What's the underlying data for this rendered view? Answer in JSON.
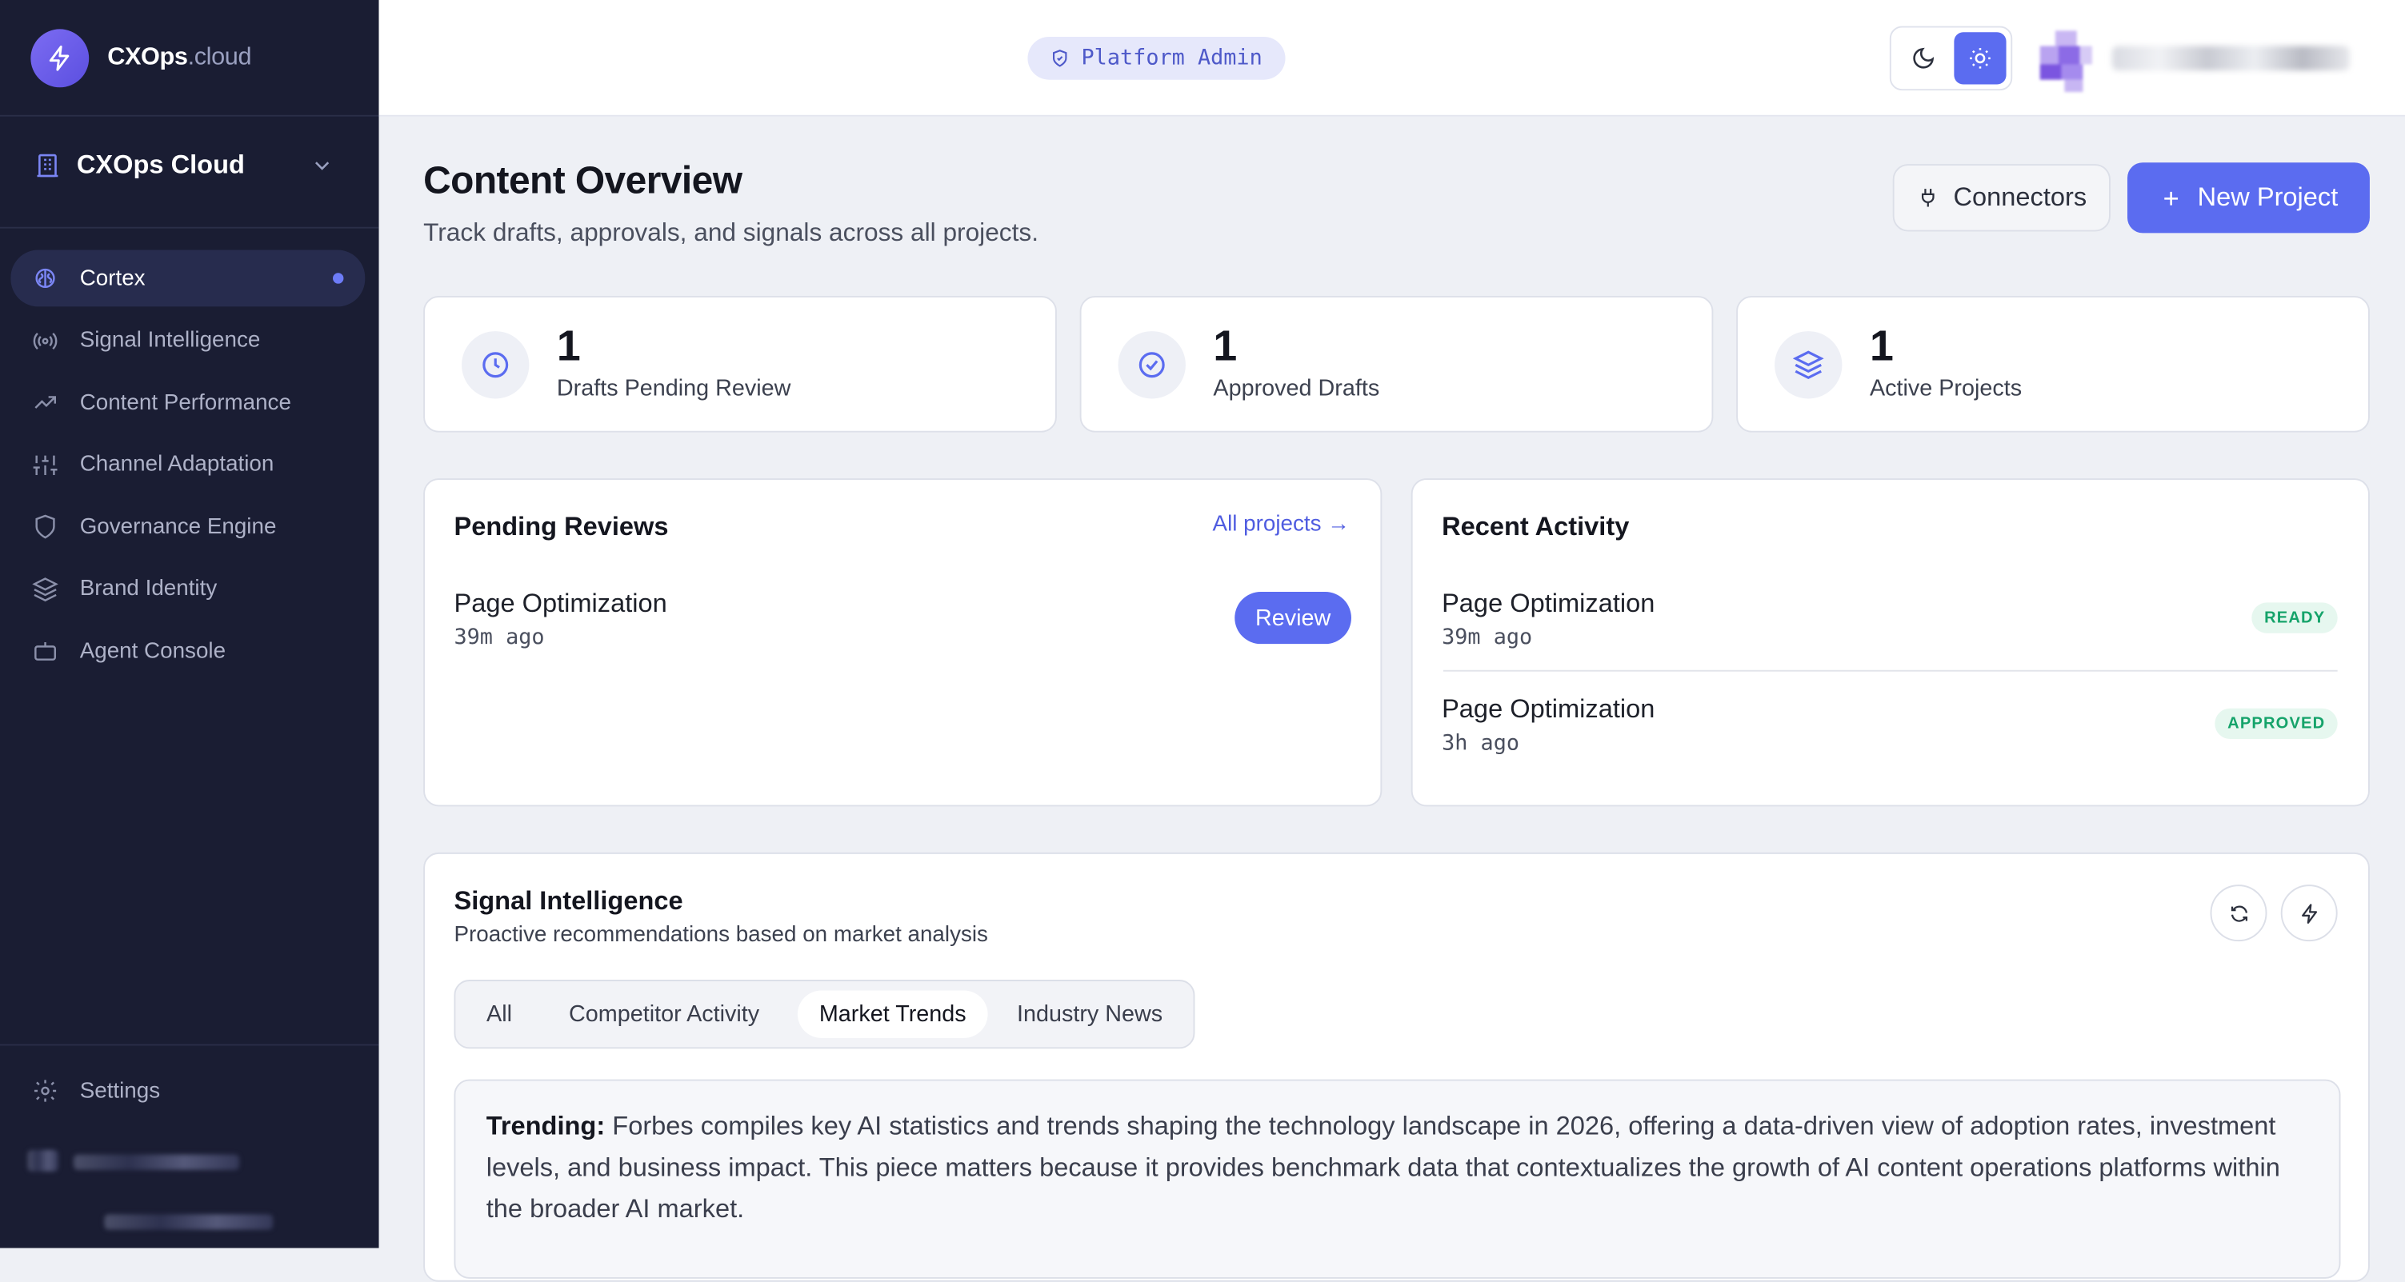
{
  "brand": {
    "name_main": "CXOps",
    "name_suffix": ".cloud"
  },
  "workspace": {
    "name": "CXOps Cloud"
  },
  "nav": {
    "items": [
      {
        "label": "Cortex",
        "icon": "brain-icon",
        "active": true
      },
      {
        "label": "Signal Intelligence",
        "icon": "broadcast-icon"
      },
      {
        "label": "Content Performance",
        "icon": "trending-up-icon"
      },
      {
        "label": "Channel Adaptation",
        "icon": "sliders-icon"
      },
      {
        "label": "Governance Engine",
        "icon": "shield-icon"
      },
      {
        "label": "Brand Identity",
        "icon": "layers-icon"
      },
      {
        "label": "Agent Console",
        "icon": "bot-icon"
      }
    ],
    "settings_label": "Settings"
  },
  "header": {
    "role_badge": "Platform Admin",
    "theme": {
      "mode": "light"
    }
  },
  "page": {
    "title": "Content Overview",
    "subtitle": "Track drafts, approvals, and signals across all projects.",
    "connectors_label": "Connectors",
    "new_project_label": "New Project"
  },
  "stats": [
    {
      "value": "1",
      "label": "Drafts Pending Review",
      "icon": "clock-icon"
    },
    {
      "value": "1",
      "label": "Approved Drafts",
      "icon": "check-circle-icon"
    },
    {
      "value": "1",
      "label": "Active Projects",
      "icon": "layers-icon"
    }
  ],
  "pending_reviews": {
    "title": "Pending Reviews",
    "link_label": "All projects →",
    "items": [
      {
        "title": "Page Optimization",
        "time": "39m ago",
        "action": "Review"
      }
    ]
  },
  "recent_activity": {
    "title": "Recent Activity",
    "items": [
      {
        "title": "Page Optimization",
        "time": "39m ago",
        "status": "READY"
      },
      {
        "title": "Page Optimization",
        "time": "3h ago",
        "status": "APPROVED"
      }
    ]
  },
  "signal_intelligence": {
    "title": "Signal Intelligence",
    "subtitle": "Proactive recommendations based on market analysis",
    "tabs": [
      "All",
      "Competitor Activity",
      "Market Trends",
      "Industry News"
    ],
    "active_tab": "Market Trends",
    "trend_label": "Trending:",
    "trend_text": "Forbes compiles key AI statistics and trends shaping the technology landscape in 2026, offering a data-driven view of adoption rates, investment levels, and business impact. This piece matters because it provides benchmark data that contextualizes the growth of AI content operations platforms within the broader AI market."
  },
  "colors": {
    "sidebar_bg": "#1a1d33",
    "accent": "#5b6cf0",
    "status_green": "#15a36a",
    "page_bg": "#eef0f5"
  }
}
